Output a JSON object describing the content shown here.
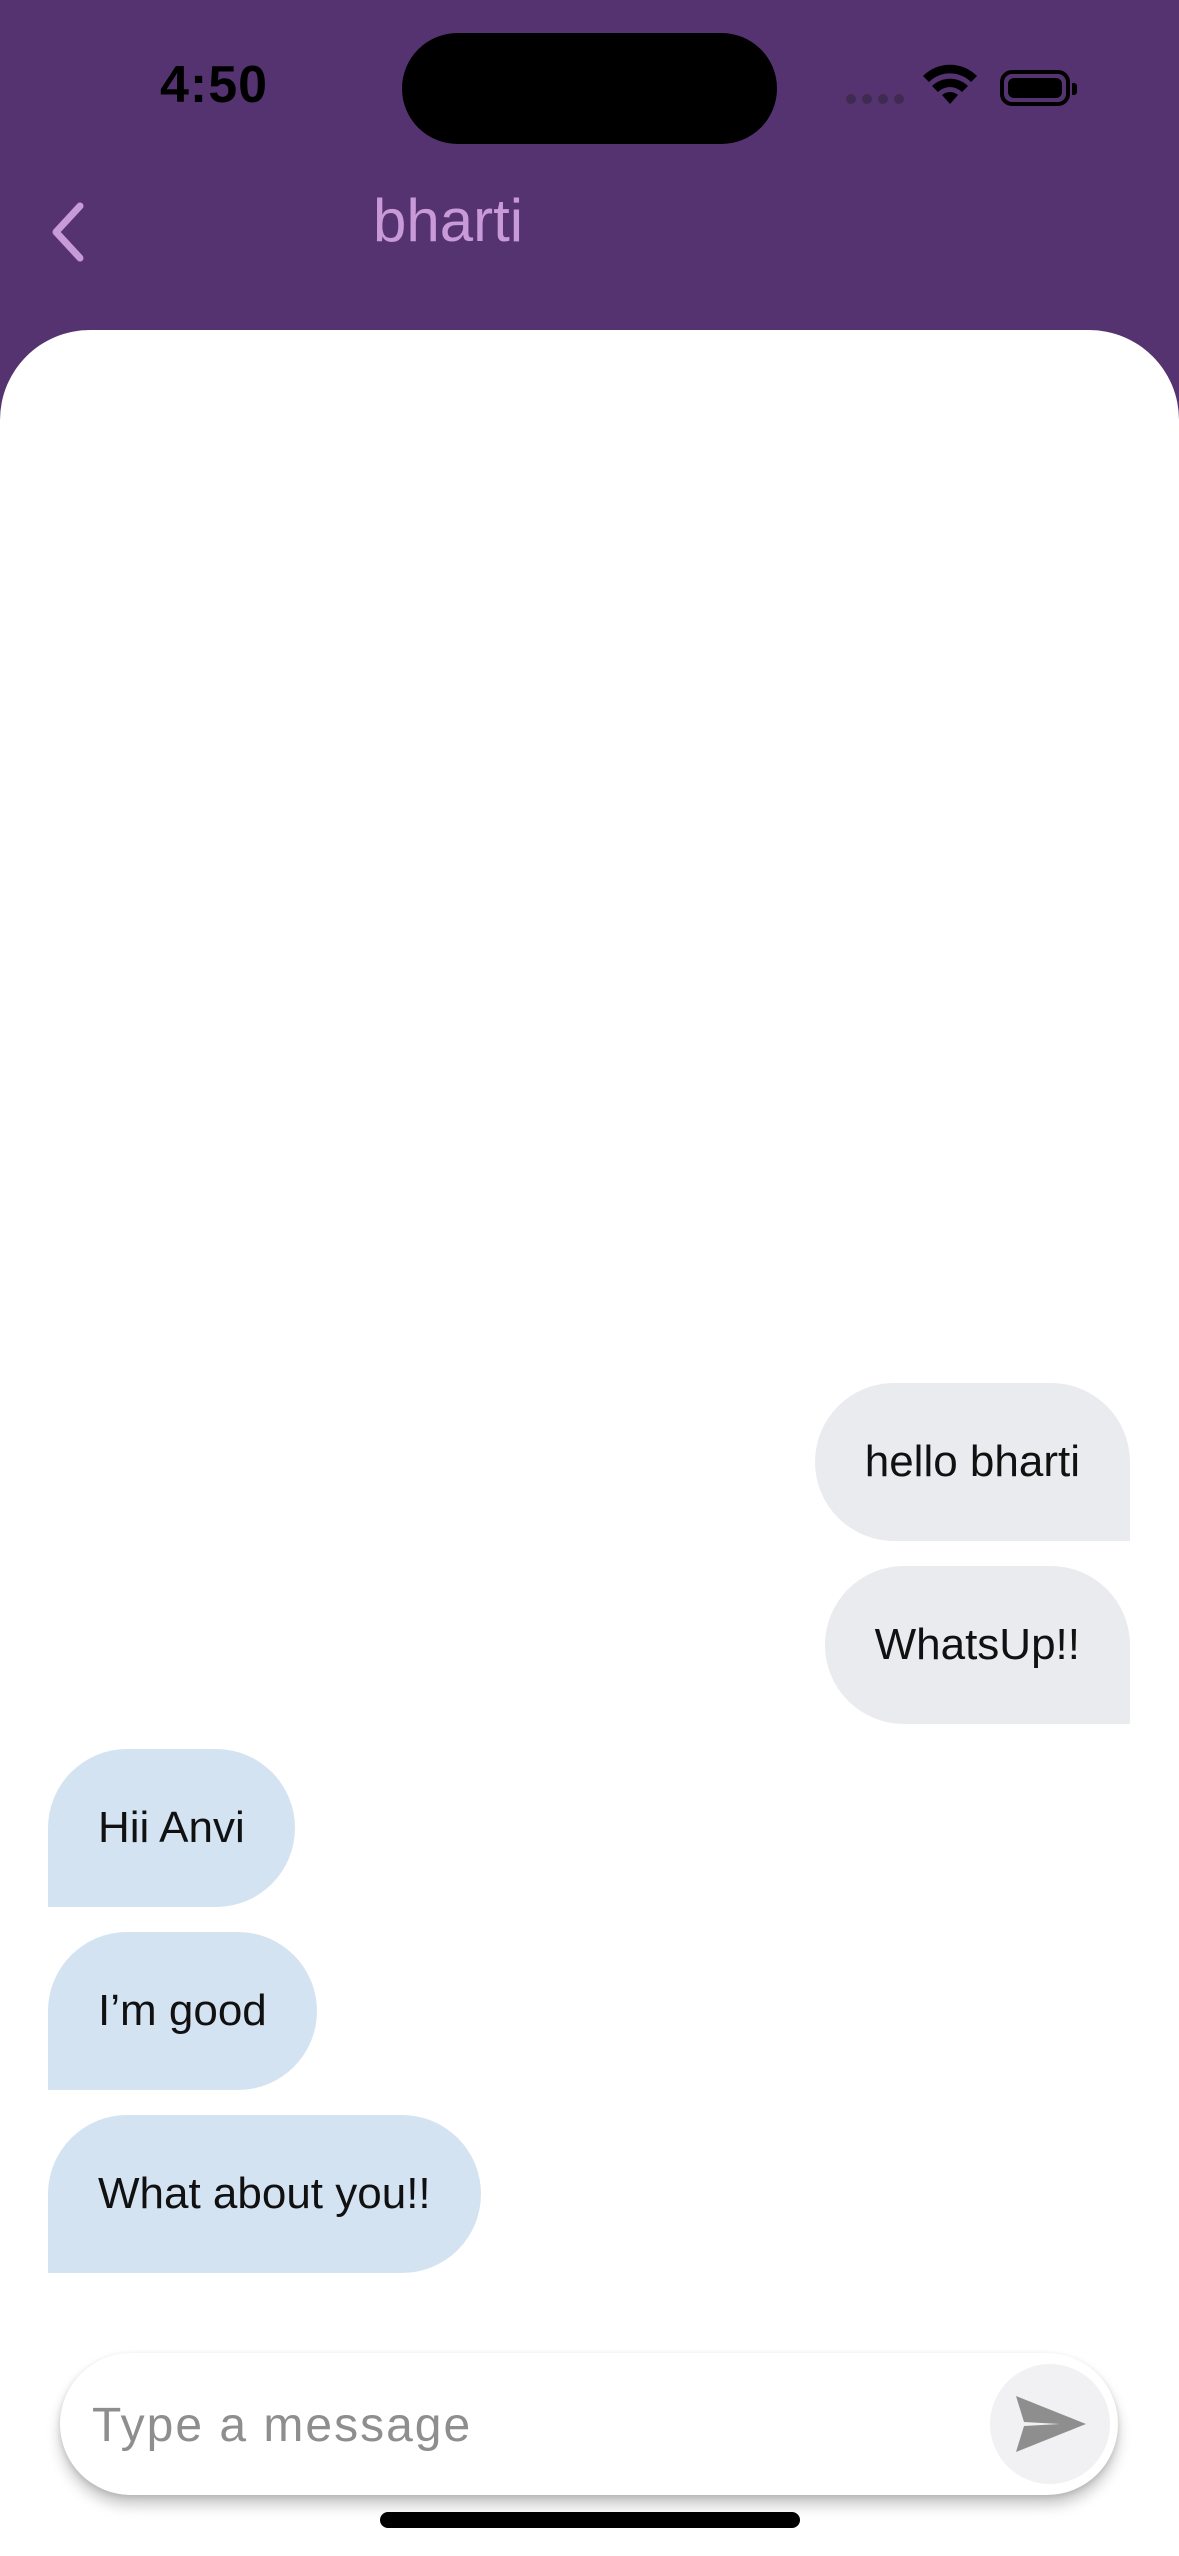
{
  "status_bar": {
    "time": "4:50",
    "icons": [
      "signal-dots-icon",
      "wifi-icon",
      "battery-icon"
    ]
  },
  "header": {
    "back_icon": "chevron-left-icon",
    "title": "bharti"
  },
  "messages": [
    {
      "text": "hello bharti",
      "direction": "sent"
    },
    {
      "text": "WhatsUp!!",
      "direction": "sent"
    },
    {
      "text": "Hii Anvi",
      "direction": "received"
    },
    {
      "text": "I’m good",
      "direction": "received"
    },
    {
      "text": "What about you!!",
      "direction": "received"
    }
  ],
  "composer": {
    "value": "",
    "placeholder": "Type a message",
    "send_icon": "send-icon"
  },
  "colors": {
    "header_bg": "#553370",
    "title": "#c99ad8",
    "sent_bubble": "#eaebef",
    "received_bubble": "#d4e3f2"
  }
}
